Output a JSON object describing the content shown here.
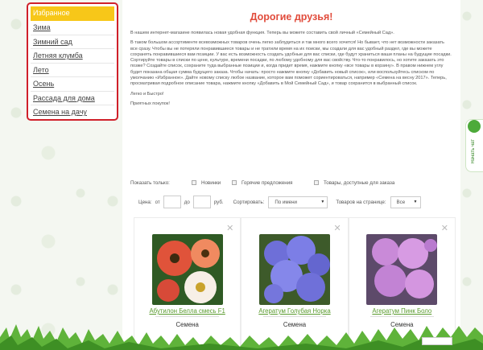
{
  "sidebar": {
    "items": [
      {
        "label": "Избранное",
        "active": true
      },
      {
        "label": "Зима"
      },
      {
        "label": "Зимний сад"
      },
      {
        "label": "Летняя клумба"
      },
      {
        "label": "Лето"
      },
      {
        "label": "Осень"
      },
      {
        "label": "Рассада для дома"
      },
      {
        "label": "Семена на дачу"
      }
    ]
  },
  "main": {
    "title": "Дорогие друзья!",
    "paragraphs": [
      "В нашем интернет-магазине появилась новая удобная функция. Теперь вы можете составить свой личный «Семейный Сад».",
      "В таком большом ассортименте всевозможных товаров очень легко заблудиться и так много всего хочется! Но бывает, что нет возможности заказать все сразу. Чтобы вы не потеряли понравившиеся товары и не тратили время на их поиски, мы создали для вас удобный раздел, где вы можете сохранять понравившиеся вам позиции. У вас есть возможность создать удобные для вас списки, где будут храниться ваши планы на будущие посадки. Сортируйте товары в списки по цене, культуре, времени посадки, по любому удобному для вас свойству. Что-то понравилось, но хотите заказать это позже? Создайте список, сохраните туда выбранные позиции и, когда придет время, нажмите кнопку «все товары в корзину». В правом нижнем углу будет показана общая сумма будущего заказа. Чтобы начать: просто нажмите кнопку «Добавить новый список», или воспользуйтесь списком по умолчанию «Избранное». Дайте новому списку любое название, которое вам поможет сориентироваться, например «Семена на весну 2017». Теперь, просматривая подробное описание товара, нажмите кнопку «Добавить в Мой Семейный Сад», и товар сохранится в выбранный список.",
      "Легко и Быстро!",
      "Приятных покупок!"
    ]
  },
  "filters": {
    "show_only_label": "Показать только:",
    "new_label": "Новинки",
    "hot_label": "Горячие предложения",
    "available_label": "Товары, доступные для заказа",
    "price_label": "Цена:",
    "from_label": "от",
    "to_label": "до",
    "currency_label": "руб.",
    "sort_label": "Сортировать:",
    "sort_value": "По имени",
    "per_page_label": "Товаров на странице:",
    "per_page_value": "Все"
  },
  "cards": [
    {
      "title": "Абутилон Белла смесь F1",
      "subtitle": "Семена",
      "image": "poppy-flowers-image"
    },
    {
      "title": "Агератум Голубая Норка",
      "subtitle": "Семена",
      "image": "blue-ageratum-image"
    },
    {
      "title": "Агератум Пинк Боло",
      "subtitle": "Семена",
      "image": "pink-ageratum-image"
    }
  ],
  "chat_tab": {
    "label": "Начать чат"
  },
  "colors": {
    "accent_red": "#d0202a",
    "title_red": "#e14c3c",
    "active_yellow": "#f7c719",
    "link_green": "#5a9b2e",
    "chat_green": "#4daa3a"
  }
}
